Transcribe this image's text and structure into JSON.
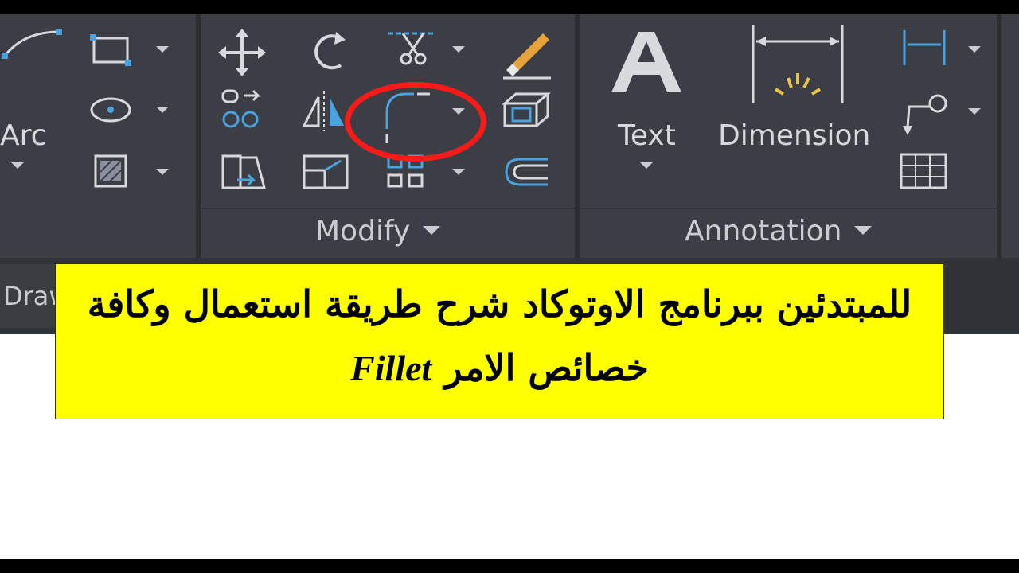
{
  "ribbon": {
    "draw_panel": {
      "arc_label": "Arc"
    },
    "modify_panel": {
      "title": "Modify"
    },
    "annotation_panel": {
      "title": "Annotation",
      "text_label": "Text",
      "dimension_label": "Dimension"
    },
    "tab_label": "Draw"
  },
  "banner": {
    "line1": "للمبتدئين ببرنامج الاوتوكاد شرح طريقة استعمال وكافة",
    "line2_arabic": "خصائص الامر",
    "line2_latin": "Fillet",
    "background_color": "#ffff00"
  },
  "highlight": {
    "color": "#ff1a1a",
    "target": "fillet-tool"
  },
  "colors": {
    "ribbon_bg": "#3c3f45",
    "icon_blue": "#4aa3df",
    "icon_gray": "#d7d9dd"
  }
}
